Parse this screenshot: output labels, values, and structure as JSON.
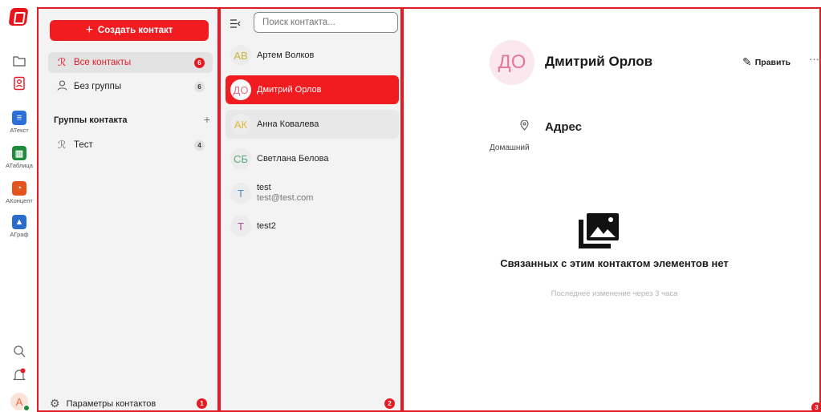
{
  "rail": {
    "apps": [
      {
        "caption": "АТекст",
        "icon": "text-doc-icon",
        "color": "#2d6fd8"
      },
      {
        "caption": "АТаблица",
        "icon": "spreadsheet-icon",
        "color": "#1f8a3b"
      },
      {
        "caption": "АКонцепт",
        "icon": "presentation-icon",
        "color": "#e5531d"
      },
      {
        "caption": "АГраф",
        "icon": "image-icon",
        "color": "#2a6cc9"
      }
    ],
    "avatar_letter": "A"
  },
  "sidebar": {
    "create_button": "Создать контакт",
    "items": [
      {
        "label": "Все контакты",
        "count": "6"
      },
      {
        "label": "Без группы",
        "count": "6"
      }
    ],
    "groups_header": "Группы контакта",
    "groups": [
      {
        "label": "Тест",
        "count": "4"
      }
    ],
    "settings_label": "Параметры контактов",
    "panel_badge": "1"
  },
  "contacts": {
    "search_placeholder": "Поиск контакта...",
    "items": [
      {
        "initials": "АВ",
        "name": "Артем Волков",
        "initials_color": "#c8b43a"
      },
      {
        "initials": "ДО",
        "name": "Дмитрий Орлов",
        "initials_color": "#e86a8a"
      },
      {
        "initials": "АК",
        "name": "Анна Ковалева",
        "initials_color": "#e0b830"
      },
      {
        "initials": "СБ",
        "name": "Светлана Белова",
        "initials_color": "#5aaa7a"
      },
      {
        "initials": "T",
        "name": "test",
        "email": "test@test.com",
        "initials_color": "#4a90c8"
      },
      {
        "initials": "T",
        "name": "test2",
        "initials_color": "#b04aa8"
      }
    ],
    "panel_badge": "2"
  },
  "detail": {
    "initials": "ДО",
    "full_name": "Дмитрий Орлов",
    "edit_label": "Править",
    "more_label": "···",
    "address_label": "Адрес",
    "address_type": "Домашний",
    "empty_title": "Связанных с этим контактом элементов нет",
    "last_modified": "Последнее изменение через 3 часа",
    "panel_badge": "3"
  },
  "colors": {
    "accent": "#e31c23",
    "panel_bg": "#f3f3f3"
  }
}
